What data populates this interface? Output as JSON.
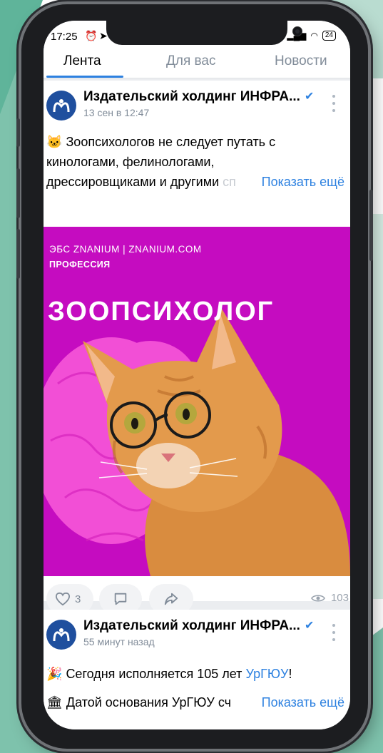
{
  "status": {
    "time": "17:25",
    "battery": "24"
  },
  "tabs": [
    {
      "label": "Лента",
      "active": true
    },
    {
      "label": "Для вас",
      "active": false
    },
    {
      "label": "Новости",
      "active": false
    }
  ],
  "posts": [
    {
      "author": "Издательский холдинг ИНФРА...",
      "time": "13 сен в 12:47",
      "text_lines": [
        "Зоопсихологов не следует путать с",
        "кинологами, фелинологами,",
        "дрессировщиками и другими",
        "сп"
      ],
      "show_more": "Показать ещё",
      "image": {
        "top_line": "ЭБС ZNANIUM  |  ZNANIUM.COM",
        "subtitle": "ПРОФЕССИЯ",
        "title": "ЗООПСИХОЛОГ"
      },
      "likes": "3",
      "views": "103"
    },
    {
      "author": "Издательский холдинг ИНФРА...",
      "time": "55 минут назад",
      "text_line1_before": "Сегодня исполняется 105 лет ",
      "text_line1_link": "УрГЮУ",
      "text_line1_after": "!",
      "text_line2": "Датой основания УрГЮУ сч",
      "show_more": "Показать ещё"
    }
  ],
  "colors": {
    "accent": "#2d81e0",
    "image_bg": "#c50cc0",
    "brand": "#1f4f9e"
  }
}
